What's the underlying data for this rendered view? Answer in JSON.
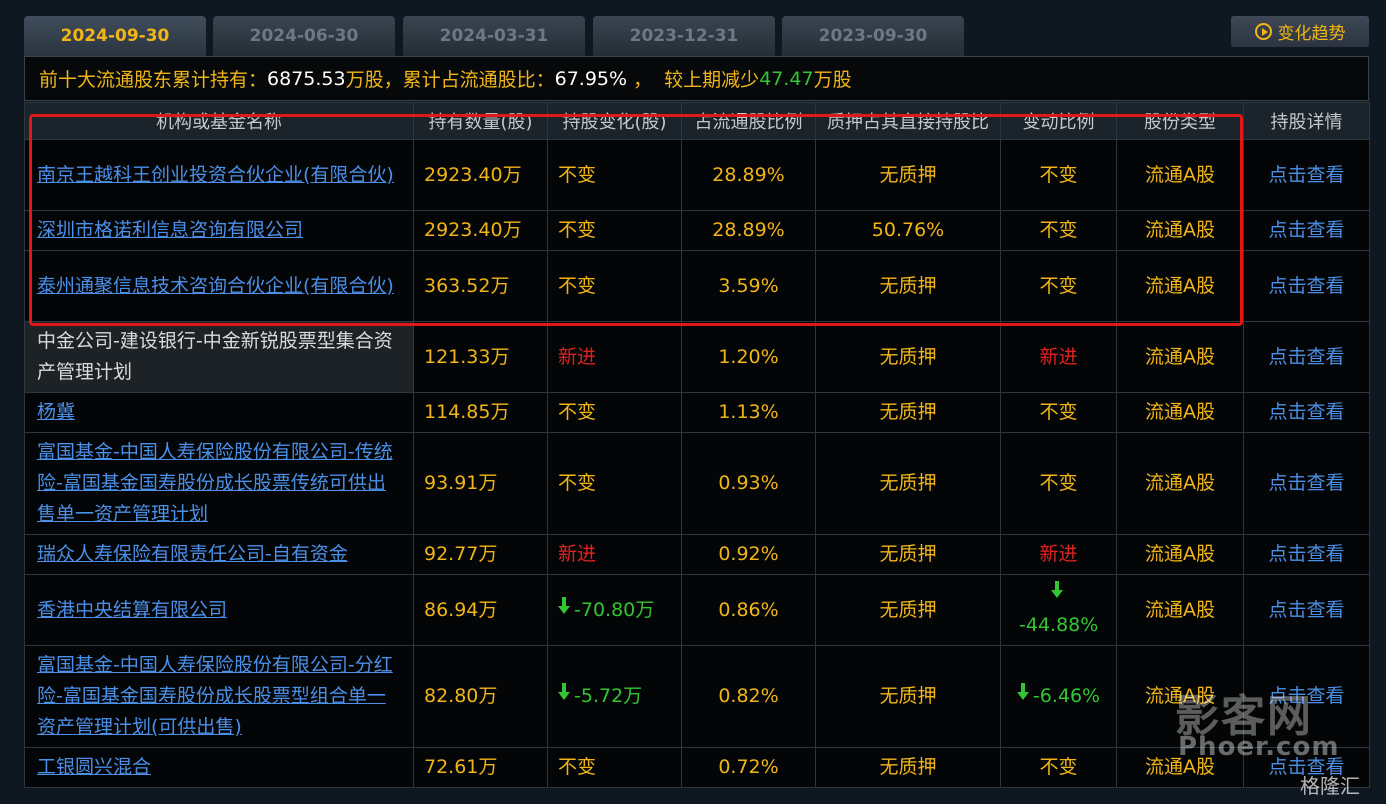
{
  "tabs": [
    "2024-09-30",
    "2024-06-30",
    "2024-03-31",
    "2023-12-31",
    "2023-09-30"
  ],
  "trend_button": "变化趋势",
  "summary": {
    "prefix": "前十大流通股东累计持有：",
    "total_shares": "6875.53",
    "unit1": "万股，累计占流通股比：",
    "ratio": "67.95%",
    "sep": " ，  较上期减少",
    "decrease": "47.47",
    "unit2": "万股"
  },
  "columns": [
    "机构或基金名称",
    "持有数量(股)",
    "持股变化(股)",
    "占流通股比例",
    "质押占其直接持股比",
    "变动比例",
    "股份类型",
    "持股详情"
  ],
  "rows": [
    {
      "name": "南京王越科王创业投资合伙企业(有限合伙)",
      "shares": "2923.40万",
      "change": "不变",
      "ratio": "28.89%",
      "pledge": "无质押",
      "change_ratio": "不变",
      "type": "流通A股",
      "detail": "点击查看"
    },
    {
      "name": "深圳市格诺利信息咨询有限公司",
      "shares": "2923.40万",
      "change": "不变",
      "ratio": "28.89%",
      "pledge": "50.76%",
      "change_ratio": "不变",
      "type": "流通A股",
      "detail": "点击查看"
    },
    {
      "name": "泰州通聚信息技术咨询合伙企业(有限合伙)",
      "shares": "363.52万",
      "change": "不变",
      "ratio": "3.59%",
      "pledge": "无质押",
      "change_ratio": "不变",
      "type": "流通A股",
      "detail": "点击查看"
    },
    {
      "name": "中金公司-建设银行-中金新锐股票型集合资产管理计划",
      "shares": "121.33万",
      "change": "新进",
      "ratio": "1.20%",
      "pledge": "无质押",
      "change_ratio": "新进",
      "type": "流通A股",
      "detail": "点击查看"
    },
    {
      "name": "杨冀",
      "shares": "114.85万",
      "change": "不变",
      "ratio": "1.13%",
      "pledge": "无质押",
      "change_ratio": "不变",
      "type": "流通A股",
      "detail": "点击查看"
    },
    {
      "name": "富国基金-中国人寿保险股份有限公司-传统险-富国基金国寿股份成长股票传统可供出售单一资产管理计划",
      "shares": "93.91万",
      "change": "不变",
      "ratio": "0.93%",
      "pledge": "无质押",
      "change_ratio": "不变",
      "type": "流通A股",
      "detail": "点击查看"
    },
    {
      "name": "瑞众人寿保险有限责任公司-自有资金",
      "shares": "92.77万",
      "change": "新进",
      "ratio": "0.92%",
      "pledge": "无质押",
      "change_ratio": "新进",
      "type": "流通A股",
      "detail": "点击查看"
    },
    {
      "name": "香港中央结算有限公司",
      "shares": "86.94万",
      "change": "-70.80万",
      "ratio": "0.86%",
      "pledge": "无质押",
      "change_ratio": "-44.88%",
      "type": "流通A股",
      "detail": "点击查看"
    },
    {
      "name": "富国基金-中国人寿保险股份有限公司-分红险-富国基金国寿股份成长股票型组合单一资产管理计划(可供出售)",
      "shares": "82.80万",
      "change": "-5.72万",
      "ratio": "0.82%",
      "pledge": "无质押",
      "change_ratio": "-6.46%",
      "type": "流通A股",
      "detail": "点击查看"
    },
    {
      "name": "工银圆兴混合",
      "shares": "72.61万",
      "change": "不变",
      "ratio": "0.72%",
      "pledge": "无质押",
      "change_ratio": "不变",
      "type": "流通A股",
      "detail": "点击查看"
    }
  ],
  "watermark": {
    "brand": "影客网",
    "url": "Phoer.com",
    "logo": "格隆汇"
  },
  "colors": {
    "accent": "#f1b518",
    "link": "#4a8fe8",
    "up_new": "#e02222",
    "down": "#33c533",
    "highlight_box": "#e01818"
  }
}
